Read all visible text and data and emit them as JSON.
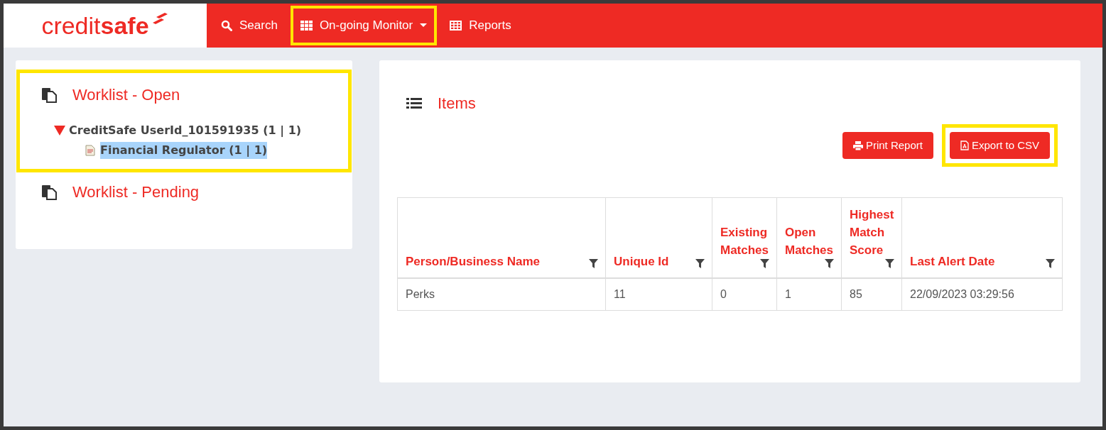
{
  "logo": {
    "part_1": "credit",
    "part_2": "safe"
  },
  "nav": [
    {
      "kind": "search",
      "label": "Search",
      "dropdown": false,
      "highlighted": false
    },
    {
      "kind": "grid",
      "label": "On-going Monitor",
      "dropdown": true,
      "highlighted": true
    },
    {
      "kind": "table",
      "label": "Reports",
      "dropdown": false,
      "highlighted": false
    }
  ],
  "worklists": [
    {
      "label": "Worklist - Open",
      "highlighted": true,
      "children": [
        {
          "label": "CreditSafe UserId_101591935 (1 | 1)",
          "expanded": true,
          "children": [
            {
              "label": "Financial Regulator (1 | 1)",
              "selected": true
            }
          ]
        }
      ]
    },
    {
      "label": "Worklist - Pending",
      "highlighted": false
    }
  ],
  "items_panel": {
    "title": "Items",
    "buttons": [
      {
        "kind": "print",
        "label": "Print Report",
        "highlighted": false
      },
      {
        "kind": "pdf",
        "label": "Export to CSV",
        "highlighted": true
      }
    ],
    "table": {
      "columns": [
        "Person/Business Name",
        "Unique Id",
        "Existing Matches",
        "Open Matches",
        "Highest Match Score",
        "Last Alert Date"
      ],
      "rows": [
        [
          "Perks",
          "11",
          "0",
          "1",
          "85",
          "22/09/2023 03:29:56"
        ]
      ]
    }
  }
}
